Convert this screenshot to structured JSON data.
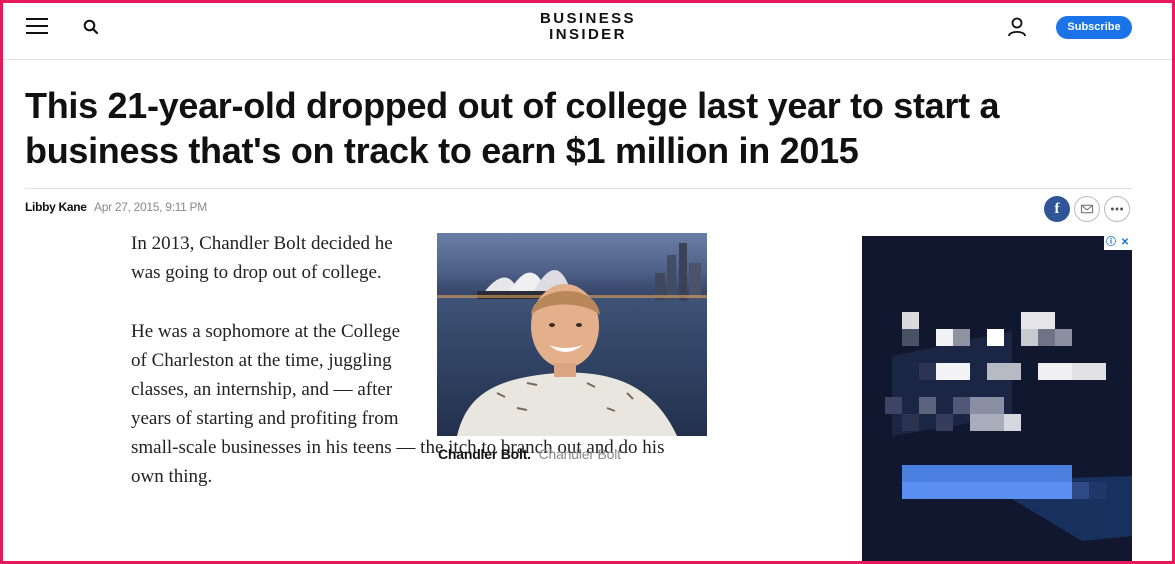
{
  "header": {
    "logo_line1": "BUSINESS",
    "logo_line2": "INSIDER",
    "subscribe_label": "Subscribe",
    "icons": [
      "menu-icon",
      "search-icon",
      "account-icon"
    ]
  },
  "article": {
    "headline": "This 21-year-old dropped out of college last year to start a business that's on track to earn $1 million in 2015",
    "author": "Libby Kane",
    "timestamp": "Apr 27, 2015, 9:11 PM",
    "share_icons": [
      "facebook-icon",
      "email-icon",
      "more-icon"
    ],
    "paragraphs": [
      "In 2013, Chandler Bolt decided he was going to drop out of college.",
      "He was a sophomore at the College of Charleston at the time, juggling classes, an internship, and — after years of starting and profiting from",
      "small-scale businesses in his teens — the itch to branch out and do his own thing."
    ],
    "image": {
      "caption_name": "Chandler Bolt.",
      "caption_credit": "Chandler Bolt"
    }
  },
  "ad": {
    "info_icon": "ⓘ",
    "close_icon": "✕"
  },
  "colors": {
    "accent": "#1a73e8",
    "frame": "#e8195a",
    "facebook": "#2f5597"
  }
}
